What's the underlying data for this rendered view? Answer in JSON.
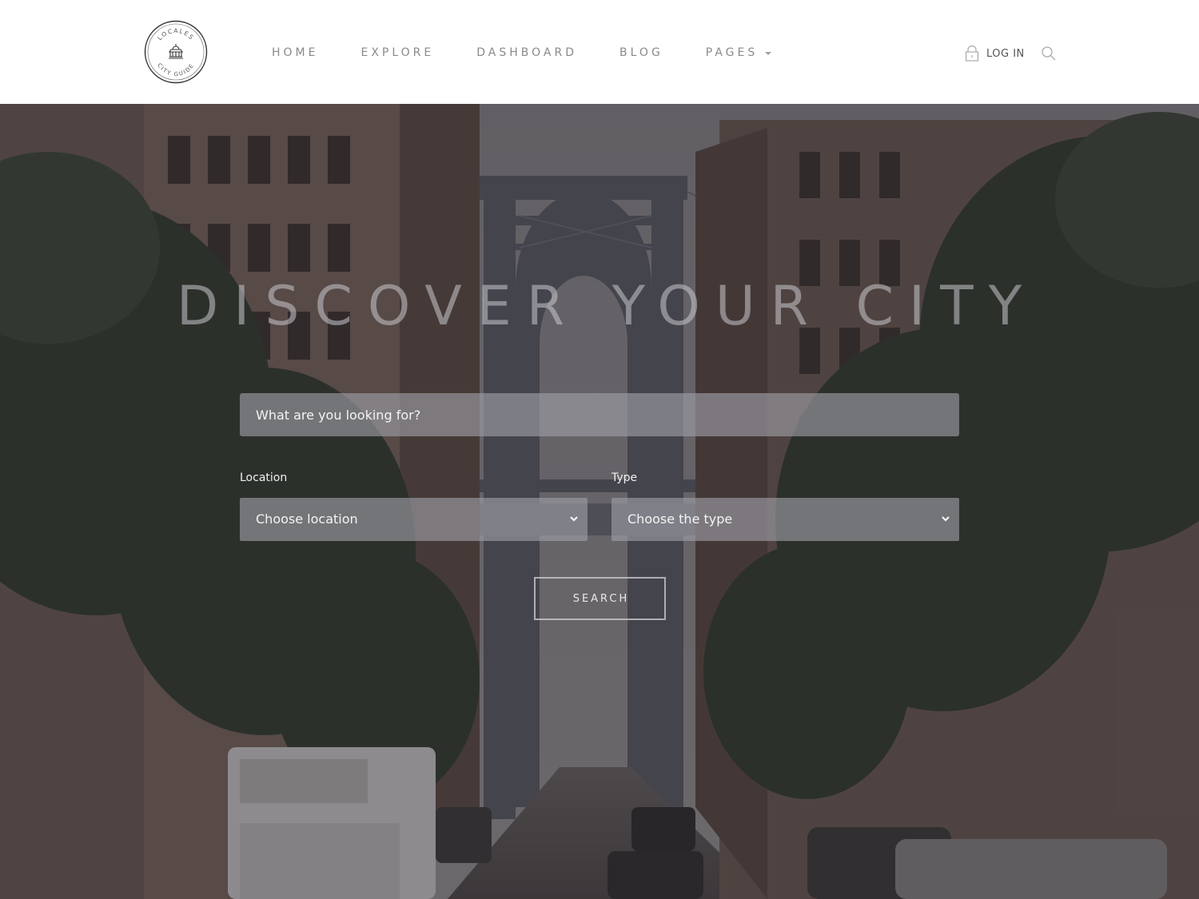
{
  "header": {
    "logo": {
      "ring_text_top": "LOCALES",
      "ring_text_bottom": "CITY GUIDE"
    },
    "nav": [
      {
        "label": "HOME"
      },
      {
        "label": "EXPLORE"
      },
      {
        "label": "DASHBOARD"
      },
      {
        "label": "BLOG"
      },
      {
        "label": "PAGES"
      }
    ],
    "login_label": "LOG IN"
  },
  "hero": {
    "title": "DISCOVER YOUR CITY",
    "search": {
      "placeholder": "What are you looking for?"
    },
    "location": {
      "label": "Location",
      "value": "Choose location"
    },
    "type": {
      "label": "Type",
      "value": "Choose the type"
    },
    "search_button": "SEARCH"
  },
  "colors": {
    "nav_text": "#8a8a8a",
    "overlay": "#262328",
    "field_bg": "#a0a0a8",
    "text_light": "#f4f4f4"
  }
}
